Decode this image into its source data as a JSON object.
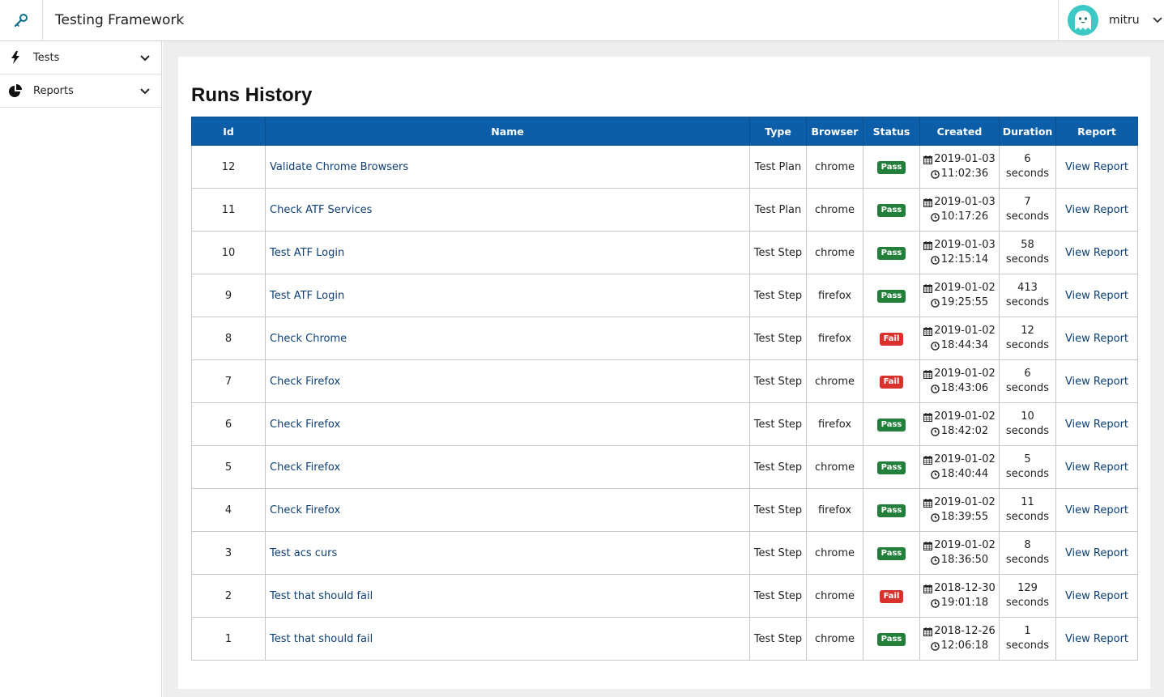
{
  "header": {
    "app_title": "Testing Framework",
    "username": "mitru"
  },
  "sidebar": {
    "items": [
      {
        "label": "Tests",
        "icon": "bolt-icon"
      },
      {
        "label": "Reports",
        "icon": "pie-chart-icon"
      }
    ]
  },
  "main": {
    "page_title": "Runs History",
    "table": {
      "headers": [
        "Id",
        "Name",
        "Type",
        "Browser",
        "Status",
        "Created",
        "Duration",
        "Report"
      ],
      "rows": [
        {
          "id": "12",
          "name": "Validate Chrome Browsers",
          "type": "Test Plan",
          "browser": "chrome",
          "status": "Pass",
          "date": "2019-01-03",
          "time": "11:02:36",
          "duration_value": "6",
          "duration_unit": "seconds",
          "report": "View Report"
        },
        {
          "id": "11",
          "name": "Check ATF Services",
          "type": "Test Plan",
          "browser": "chrome",
          "status": "Pass",
          "date": "2019-01-03",
          "time": "10:17:26",
          "duration_value": "7",
          "duration_unit": "seconds",
          "report": "View Report"
        },
        {
          "id": "10",
          "name": "Test ATF Login",
          "type": "Test Step",
          "browser": "chrome",
          "status": "Pass",
          "date": "2019-01-03",
          "time": "12:15:14",
          "duration_value": "58",
          "duration_unit": "seconds",
          "report": "View Report"
        },
        {
          "id": "9",
          "name": "Test ATF Login",
          "type": "Test Step",
          "browser": "firefox",
          "status": "Pass",
          "date": "2019-01-02",
          "time": "19:25:55",
          "duration_value": "413",
          "duration_unit": "seconds",
          "report": "View Report"
        },
        {
          "id": "8",
          "name": "Check Chrome",
          "type": "Test Step",
          "browser": "firefox",
          "status": "Fail",
          "date": "2019-01-02",
          "time": "18:44:34",
          "duration_value": "12",
          "duration_unit": "seconds",
          "report": "View Report"
        },
        {
          "id": "7",
          "name": "Check Firefox",
          "type": "Test Step",
          "browser": "chrome",
          "status": "Fail",
          "date": "2019-01-02",
          "time": "18:43:06",
          "duration_value": "6",
          "duration_unit": "seconds",
          "report": "View Report"
        },
        {
          "id": "6",
          "name": "Check Firefox",
          "type": "Test Step",
          "browser": "firefox",
          "status": "Pass",
          "date": "2019-01-02",
          "time": "18:42:02",
          "duration_value": "10",
          "duration_unit": "seconds",
          "report": "View Report"
        },
        {
          "id": "5",
          "name": "Check Firefox",
          "type": "Test Step",
          "browser": "chrome",
          "status": "Pass",
          "date": "2019-01-02",
          "time": "18:40:44",
          "duration_value": "5",
          "duration_unit": "seconds",
          "report": "View Report"
        },
        {
          "id": "4",
          "name": "Check Firefox",
          "type": "Test Step",
          "browser": "firefox",
          "status": "Pass",
          "date": "2019-01-02",
          "time": "18:39:55",
          "duration_value": "11",
          "duration_unit": "seconds",
          "report": "View Report"
        },
        {
          "id": "3",
          "name": "Test acs curs",
          "type": "Test Step",
          "browser": "chrome",
          "status": "Pass",
          "date": "2019-01-02",
          "time": "18:36:50",
          "duration_value": "8",
          "duration_unit": "seconds",
          "report": "View Report"
        },
        {
          "id": "2",
          "name": "Test that should fail",
          "type": "Test Step",
          "browser": "chrome",
          "status": "Fail",
          "date": "2018-12-30",
          "time": "19:01:18",
          "duration_value": "129",
          "duration_unit": "seconds",
          "report": "View Report"
        },
        {
          "id": "1",
          "name": "Test that should fail",
          "type": "Test Step",
          "browser": "chrome",
          "status": "Pass",
          "date": "2018-12-26",
          "time": "12:06:18",
          "duration_value": "1",
          "duration_unit": "seconds",
          "report": "View Report"
        }
      ]
    }
  },
  "colors": {
    "header_blue": "#0c5ea8",
    "pass_green": "#23803a",
    "fail_red": "#d9322d",
    "link": "#0e3f73",
    "avatar_teal": "#3cc8c4"
  }
}
